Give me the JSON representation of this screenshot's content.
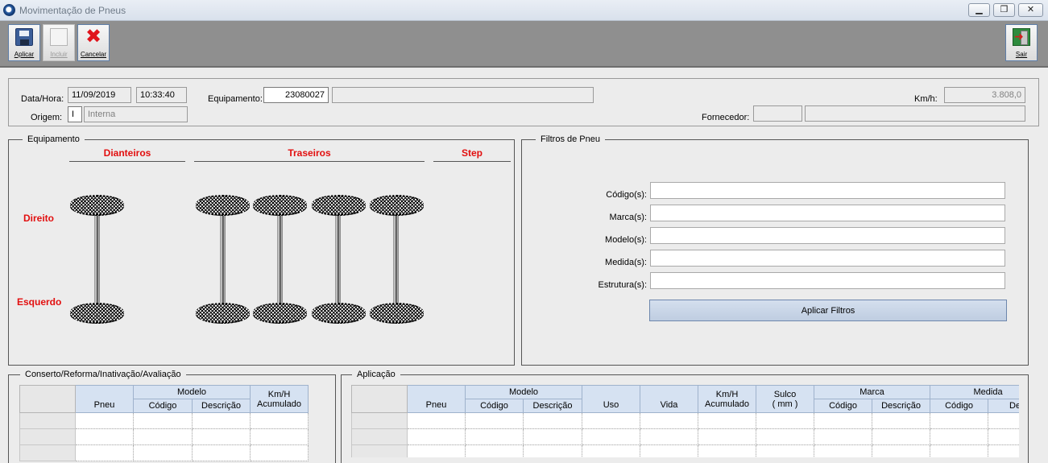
{
  "window": {
    "title": "Movimentação de Pneus",
    "controls": [
      "minimize",
      "maximize",
      "close"
    ]
  },
  "toolbar": {
    "aplicar": "Aplicar",
    "incluir": "Incluir",
    "cancelar": "Cancelar",
    "sair": "Sair"
  },
  "header": {
    "data_hora_label": "Data/Hora:",
    "date": "11/09/2019",
    "time": "10:33:40",
    "equipamento_label": "Equipamento:",
    "equipamento_code": "23080027",
    "equipamento_desc": "",
    "kmh_label": "Km/h:",
    "kmh_value": "3.808,0",
    "origem_label": "Origem:",
    "origem_code": "I",
    "origem_desc": "Interna",
    "fornecedor_label": "Fornecedor:",
    "fornecedor_code": "",
    "fornecedor_desc": ""
  },
  "equipamento": {
    "title": "Equipamento",
    "dianteiros": "Dianteiros",
    "traseiros": "Traseiros",
    "step": "Step",
    "direito": "Direito",
    "esquerdo": "Esquerdo"
  },
  "filtros": {
    "title": "Filtros de Pneu",
    "codigos_label": "Código(s):",
    "marcas_label": "Marca(s):",
    "modelos_label": "Modelo(s):",
    "medidas_label": "Medida(s):",
    "estruturas_label": "Estrutura(s):",
    "codigos_value": "",
    "marcas_value": "",
    "modelos_value": "",
    "medidas_value": "",
    "estruturas_value": "",
    "apply_button": "Aplicar Filtros"
  },
  "conserto": {
    "title": "Conserto/Reforma/Inativação/Avaliação",
    "headers": {
      "pneu": "Pneu",
      "modelo": "Modelo",
      "codigo": "Código",
      "descricao": "Descrição",
      "km_h": "Km/H",
      "acumulado": "Acumulado"
    },
    "rows": [
      [
        "",
        "",
        "",
        ""
      ],
      [
        "",
        "",
        "",
        ""
      ],
      [
        "",
        "",
        "",
        ""
      ]
    ]
  },
  "aplicacao": {
    "title": "Aplicação",
    "headers": {
      "pneu": "Pneu",
      "modelo": "Modelo",
      "codigo": "Código",
      "descricao": "Descrição",
      "uso": "Uso",
      "vida": "Vida",
      "km_h": "Km/H",
      "acumulado": "Acumulado",
      "sulco": "Sulco",
      "sulco_unit": "( mm )",
      "marca": "Marca",
      "marca_codigo": "Código",
      "marca_descricao": "Descrição",
      "medida": "Medida",
      "medida_codigo": "Código",
      "medida_descricao": "Desc"
    },
    "rows": [
      [
        "",
        "",
        "",
        "",
        "",
        "",
        "",
        "",
        "",
        "",
        ""
      ],
      [
        "",
        "",
        "",
        "",
        "",
        "",
        "",
        "",
        "",
        "",
        ""
      ],
      [
        "",
        "",
        "",
        "",
        "",
        "",
        "",
        "",
        "",
        "",
        ""
      ]
    ]
  }
}
